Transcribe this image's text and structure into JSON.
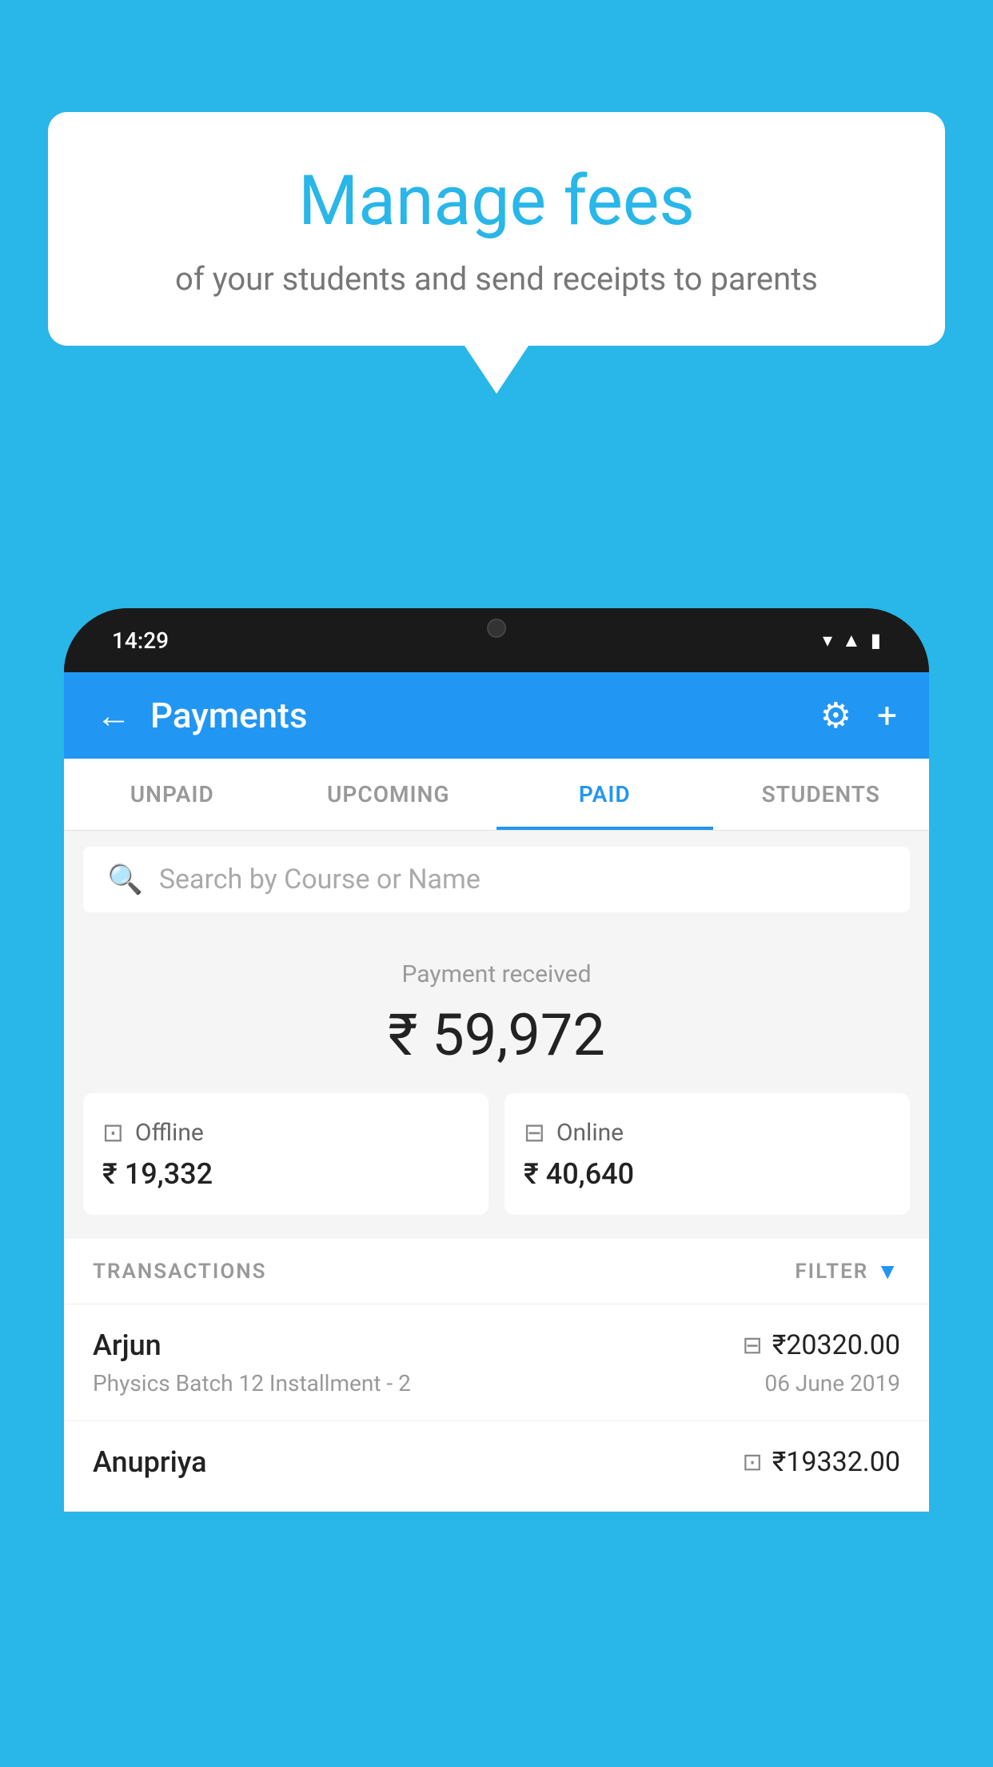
{
  "background_color": "#29b6e8",
  "bubble": {
    "title": "Manage fees",
    "subtitle": "of your students and send receipts to parents"
  },
  "phone": {
    "time": "14:29",
    "header": {
      "title": "Payments",
      "back_label": "←",
      "settings_label": "⚙",
      "add_label": "+"
    },
    "tabs": [
      {
        "label": "UNPAID",
        "active": false
      },
      {
        "label": "UPCOMING",
        "active": false
      },
      {
        "label": "PAID",
        "active": true
      },
      {
        "label": "STUDENTS",
        "active": false
      }
    ],
    "search": {
      "placeholder": "Search by Course or Name"
    },
    "payment_summary": {
      "label": "Payment received",
      "total": "₹ 59,972",
      "offline_label": "Offline",
      "offline_amount": "₹ 19,332",
      "online_label": "Online",
      "online_amount": "₹ 40,640"
    },
    "transactions": {
      "label": "TRANSACTIONS",
      "filter_label": "FILTER",
      "rows": [
        {
          "name": "Arjun",
          "course": "Physics Batch 12 Installment - 2",
          "amount": "₹20320.00",
          "date": "06 June 2019",
          "payment_type": "online"
        },
        {
          "name": "Anupriya",
          "course": "",
          "amount": "₹19332.00",
          "date": "",
          "payment_type": "offline"
        }
      ]
    }
  }
}
